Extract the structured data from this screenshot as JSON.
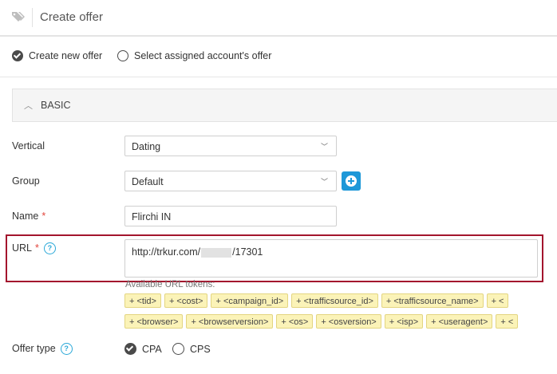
{
  "header": {
    "title": "Create offer",
    "icon": "tag-icon"
  },
  "mode": {
    "options": [
      {
        "label": "Create new offer",
        "checked": true
      },
      {
        "label": "Select assigned account's offer",
        "checked": false
      }
    ]
  },
  "section": {
    "title": "BASIC",
    "chevron": "chevron-up-icon"
  },
  "fields": {
    "vertical": {
      "label": "Vertical",
      "value": "Dating"
    },
    "group": {
      "label": "Group",
      "value": "Default"
    },
    "name": {
      "label": "Name",
      "required": "*",
      "value": "Flirchi IN"
    },
    "url": {
      "label": "URL",
      "required": "*",
      "help": "?",
      "value_prefix": "http://trkur.com/",
      "value_suffix": "/17301"
    }
  },
  "tokens": {
    "label": "Available URL tokens:",
    "row1": [
      "+ <tid>",
      "+ <cost>",
      "+ <campaign_id>",
      "+ <trafficsource_id>",
      "+ <trafficsource_name>",
      "+ <"
    ],
    "row2": [
      "+ <browser>",
      "+ <browserversion>",
      "+ <os>",
      "+ <osversion>",
      "+ <isp>",
      "+ <useragent>",
      "+ <"
    ]
  },
  "offer_type": {
    "label": "Offer type",
    "help": "?",
    "options": [
      {
        "label": "CPA",
        "checked": true
      },
      {
        "label": "CPS",
        "checked": false
      }
    ]
  },
  "colors": {
    "accent": "#1e98d8",
    "highlight": "#a3152d",
    "required": "#e2453c",
    "token_bg": "#fbf3b8"
  }
}
